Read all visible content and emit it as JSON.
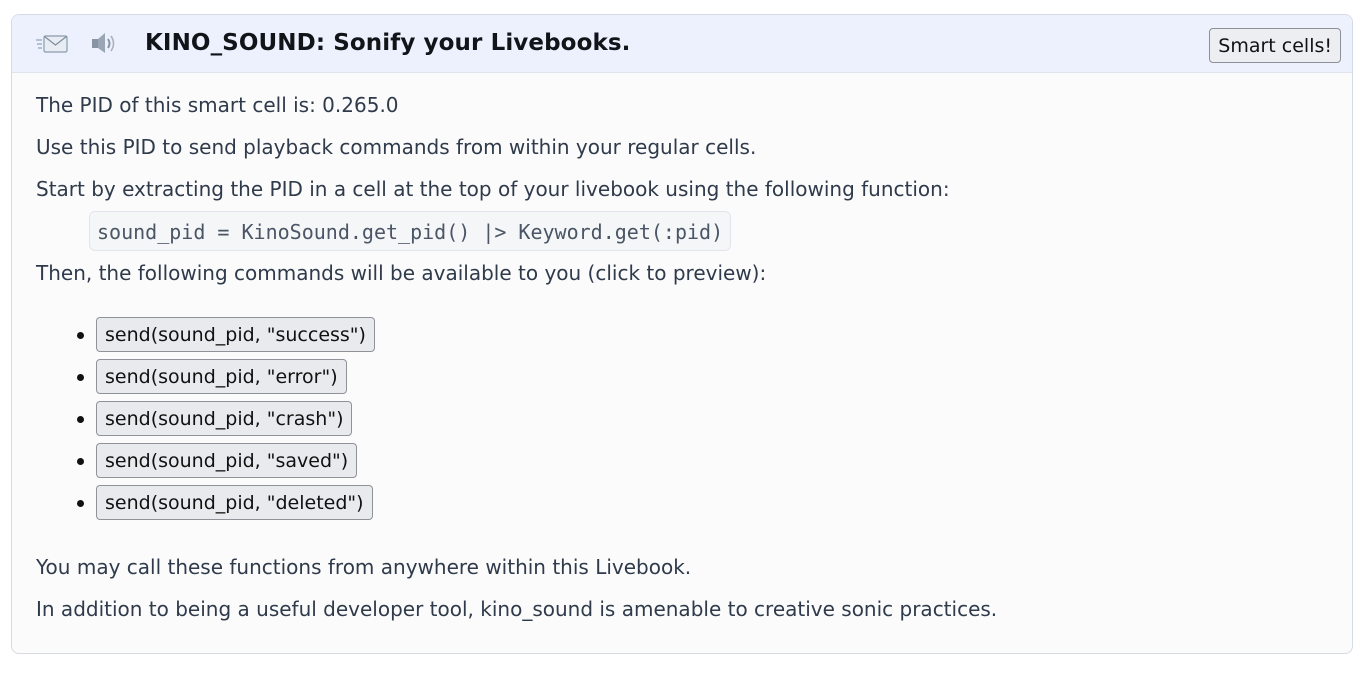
{
  "header": {
    "icons": [
      "envelope-icon",
      "speaker-icon"
    ],
    "title": "KINO_SOUND: Sonify your Livebooks.",
    "smart_cells_button": "Smart cells!"
  },
  "content": {
    "pid_line": "The PID of this smart cell is: 0.265.0",
    "usage_line": "Use this PID to send playback commands from within your regular cells.",
    "start_line": "Start by extracting the PID in a cell at the top of your livebook using the following function:",
    "code_snippet": "sound_pid = KinoSound.get_pid() |> Keyword.get(:pid)",
    "commands_intro": "Then, the following commands will be available to you (click to preview):",
    "commands": [
      "send(sound_pid, \"success\")",
      "send(sound_pid, \"error\")",
      "send(sound_pid, \"crash\")",
      "send(sound_pid, \"saved\")",
      "send(sound_pid, \"deleted\")"
    ],
    "anywhere_line": "You may call these functions from anywhere within this Livebook.",
    "creative_line": "In addition to being a useful developer tool, kino_sound is amenable to creative sonic practices."
  },
  "colors": {
    "header_bg": "#edf1fd",
    "card_bg": "#fbfbfc",
    "text": "#2f3a4a",
    "title": "#111418"
  }
}
